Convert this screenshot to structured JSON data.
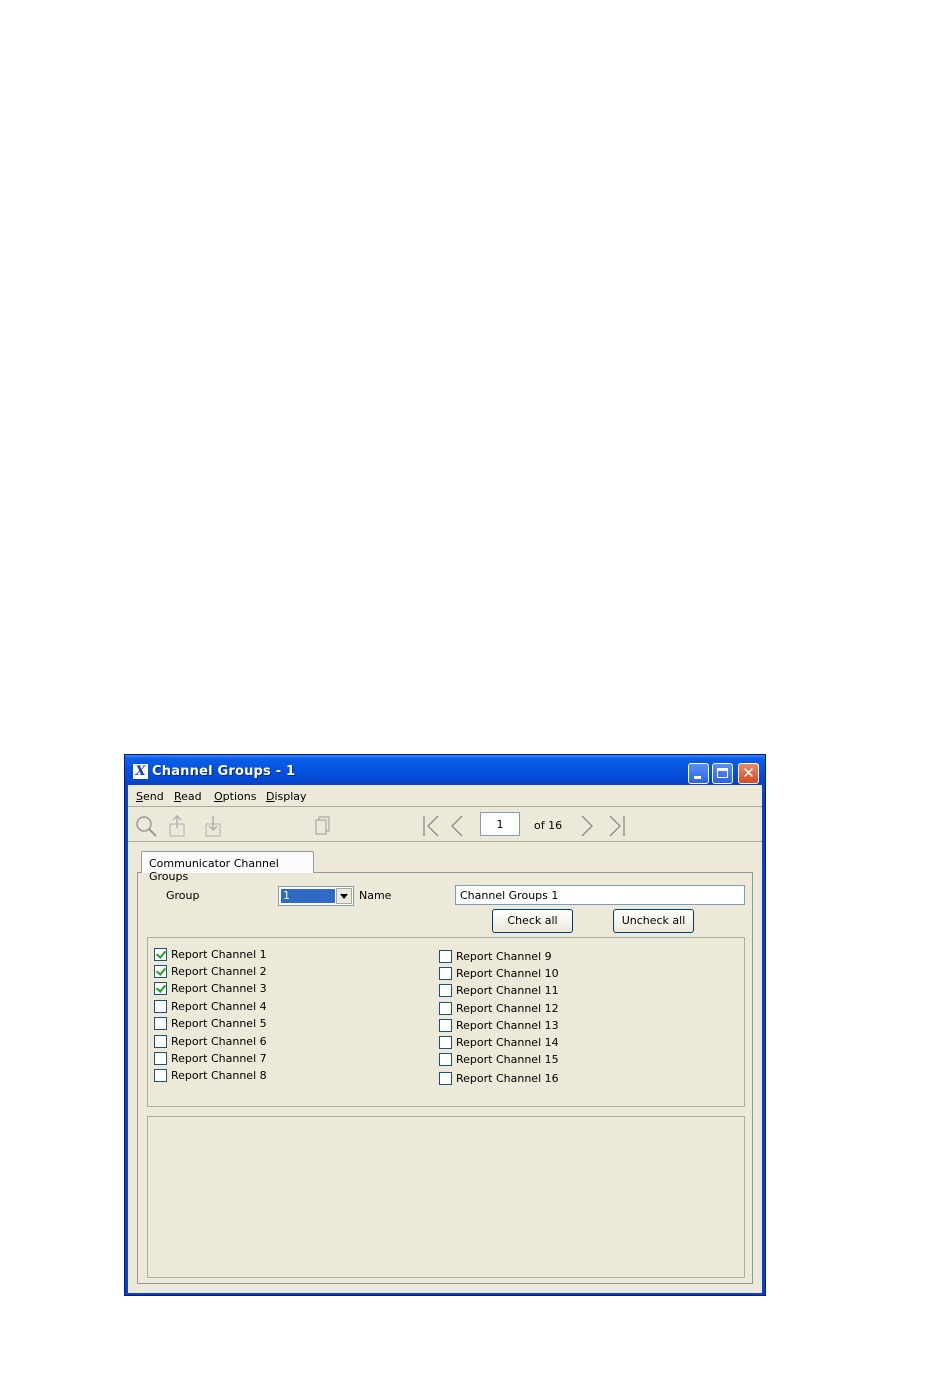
{
  "window": {
    "title": "Channel Groups - 1",
    "app_icon": "X"
  },
  "titlebar_buttons": {
    "close_glyph": "✕"
  },
  "menu": [
    {
      "label": "Send"
    },
    {
      "label": "Read"
    },
    {
      "label": "Options"
    },
    {
      "label": "Display"
    }
  ],
  "toolbar": {
    "icons": [
      "search-icon",
      "upload-icon",
      "download-icon",
      "copy-icon",
      "first-page-icon",
      "previous-page-icon",
      "next-page-icon",
      "last-page-icon"
    ],
    "page_value": "1",
    "page_of": "of 16"
  },
  "tab": {
    "label": "Communicator Channel Groups"
  },
  "form": {
    "group_label": "Group",
    "group_value": "1",
    "name_label": "Name",
    "name_value": "Channel Groups 1",
    "check_all": "Check all",
    "uncheck_all": "Uncheck all"
  },
  "channels": [
    {
      "label": "Report Channel 1",
      "checked": true
    },
    {
      "label": "Report Channel 2",
      "checked": true
    },
    {
      "label": "Report Channel 3",
      "checked": true
    },
    {
      "label": "Report Channel 4",
      "checked": false
    },
    {
      "label": "Report Channel 5",
      "checked": false
    },
    {
      "label": "Report Channel 6",
      "checked": false
    },
    {
      "label": "Report Channel 7",
      "checked": false
    },
    {
      "label": "Report Channel 8",
      "checked": false
    },
    {
      "label": "Report Channel 9",
      "checked": false
    },
    {
      "label": "Report Channel 10",
      "checked": false
    },
    {
      "label": "Report Channel 11",
      "checked": false
    },
    {
      "label": "Report Channel 12",
      "checked": false
    },
    {
      "label": "Report Channel 13",
      "checked": false
    },
    {
      "label": "Report Channel 14",
      "checked": false
    },
    {
      "label": "Report Channel 15",
      "checked": false
    },
    {
      "label": "Report Channel 16",
      "checked": false
    }
  ],
  "colors": {
    "titlebar": "#0553de",
    "client_bg": "#ece9d8",
    "selection": "#316ac5",
    "check": "#21a121"
  }
}
